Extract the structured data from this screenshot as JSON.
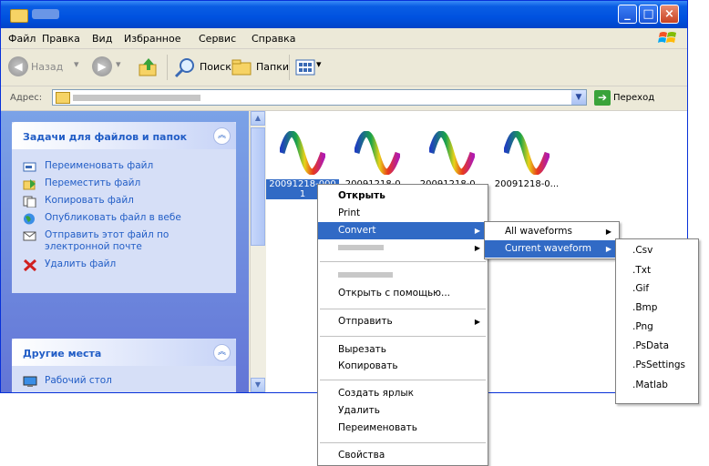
{
  "menubar": {
    "items": [
      "Файл",
      "Правка",
      "Вид",
      "Избранное",
      "Сервис",
      "Справка"
    ]
  },
  "toolbar": {
    "back": "Назад",
    "search": "Поиск",
    "folders": "Папки"
  },
  "addressbar": {
    "label": "Адрес:",
    "go": "Переход"
  },
  "tasks": {
    "title": "Задачи для файлов и папок",
    "items": [
      "Переименовать файл",
      "Переместить файл",
      "Копировать файл",
      "Опубликовать файл в вебе",
      "Отправить этот файл по электронной почте",
      "Удалить файл"
    ]
  },
  "other_places": {
    "title": "Другие места",
    "items": [
      "Рабочий стол"
    ]
  },
  "files": [
    {
      "label": "20091218-000 1"
    },
    {
      "label": "20091218-0..."
    },
    {
      "label": "20091218-0..."
    },
    {
      "label": "20091218-0..."
    }
  ],
  "context_menu": {
    "open": "Открыть",
    "print": "Print",
    "convert": "Convert",
    "open_with": "Открыть с помощью...",
    "send_to": "Отправить",
    "cut": "Вырезать",
    "copy": "Копировать",
    "create_shortcut": "Создать ярлык",
    "delete": "Удалить",
    "rename": "Переименовать",
    "properties": "Свойства"
  },
  "convert_submenu": {
    "all": "All waveforms",
    "current": "Current waveform"
  },
  "formats": [
    ".Csv",
    ".Txt",
    ".Gif",
    ".Bmp",
    ".Png",
    ".PsData",
    ".PsSettings",
    ".Matlab"
  ],
  "colors": {
    "selection": "#316ac5",
    "titlebar": "#0052e0",
    "taskpane": "#6375d6"
  },
  "icons": [
    "folder-icon",
    "windows-logo-icon",
    "back-icon",
    "forward-icon",
    "up-icon",
    "search-icon",
    "folders-icon",
    "views-icon",
    "go-icon",
    "waveform-file-icon"
  ]
}
